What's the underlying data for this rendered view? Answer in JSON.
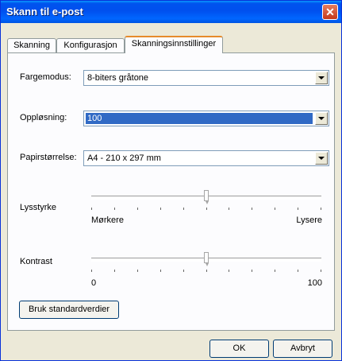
{
  "window": {
    "title": "Skann til e-post",
    "close_glyph": "✕"
  },
  "tabs": [
    {
      "label": "Skanning"
    },
    {
      "label": "Konfigurasjon"
    },
    {
      "label": "Skanningsinnstillinger"
    }
  ],
  "settings": {
    "color_mode": {
      "label": "Fargemodus:",
      "value": "8-biters gråtone"
    },
    "resolution": {
      "label": "Oppløsning:",
      "value": "100"
    },
    "paper_size": {
      "label": "Papirstørrelse:",
      "value": "A4 - 210 x 297 mm"
    },
    "brightness": {
      "label": "Lysstyrke",
      "min_label": "Mørkere",
      "max_label": "Lysere",
      "level": 0.5
    },
    "contrast": {
      "label": "Kontrast",
      "min_label": "0",
      "max_label": "100",
      "level": 0.5
    }
  },
  "buttons": {
    "defaults": "Bruk standardverdier",
    "ok": "OK",
    "cancel": "Avbryt"
  },
  "colors": {
    "titlebar": "#0054e3",
    "selection": "#316ac5",
    "tab_highlight": "#e68b2c"
  }
}
